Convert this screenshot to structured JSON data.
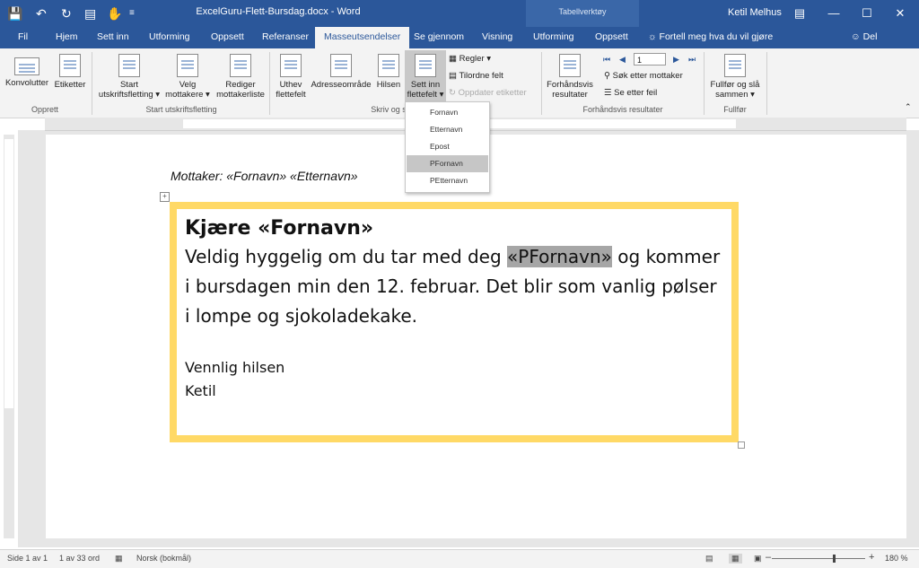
{
  "titlebar": {
    "doc_title": "ExcelGuru-Flett-Bursdag.docx - Word",
    "context_tab": "Tabellverktøy",
    "user": "Ketil Melhus",
    "qa_icons": [
      "save-icon",
      "undo-icon",
      "redo-icon",
      "print-preview-icon",
      "touch-mode-icon",
      "customize-icon"
    ]
  },
  "tabs": {
    "file": "Fil",
    "home": "Hjem",
    "insert": "Sett inn",
    "design": "Utforming",
    "layout": "Oppsett",
    "references": "Referanser",
    "mailings": "Masseutsendelser",
    "review": "Se gjennom",
    "view": "Visning",
    "table_design": "Utforming",
    "table_layout": "Oppsett",
    "tellme": "Fortell meg hva du vil gjøre",
    "share": "Del"
  },
  "ribbon": {
    "envelopes": "Konvolutter",
    "labels": "Etiketter",
    "group_create": "Opprett",
    "start_merge": [
      "Start",
      "utskriftsfletting"
    ],
    "select_recipients": [
      "Velg",
      "mottakere"
    ],
    "edit_recipients": [
      "Rediger",
      "mottakerliste"
    ],
    "group_start": "Start utskriftsfletting",
    "highlight": [
      "Uthev",
      "flettefelt"
    ],
    "address_block": "Adresseområde",
    "greeting": "Hilsen",
    "insert_field": [
      "Sett inn",
      "flettefelt"
    ],
    "rules": "Regler",
    "match_fields": "Tilordne felt",
    "update_labels": "Oppdater etiketter",
    "group_write": "Skriv og s",
    "preview": [
      "Forhåndsvis",
      "resultater"
    ],
    "record": "1",
    "find_recipient": "Søk etter mottaker",
    "check_errors": "Se etter feil",
    "group_preview": "Forhåndsvis resultater",
    "finish": [
      "Fullfør og slå",
      "sammen"
    ],
    "group_finish": "Fullfør"
  },
  "dropdown": {
    "items": [
      "Fornavn",
      "Etternavn",
      "Epost",
      "PFornavn",
      "PEtternavn"
    ],
    "highlighted": "PFornavn"
  },
  "document": {
    "recipient_line": "Mottaker: «Fornavn» «Etternavn»",
    "greeting": "Kjære «Fornavn»",
    "body_pre": "Veldig hyggelig om du tar med deg ",
    "body_field": "«PFornavn»",
    "body_post": " og kommer i bursdagen min den 12. februar. Det blir som vanlig pølser i lompe og sjokoladekake.",
    "closing": "Vennlig hilsen",
    "signature": "Ketil"
  },
  "statusbar": {
    "page": "Side 1 av 1",
    "words": "1 av 33 ord",
    "language": "Norsk (bokmål)",
    "zoom": "180 %"
  },
  "colors": {
    "word_blue": "#2b579a",
    "frame_yellow": "#ffd966",
    "field_highlight": "#a6a6a6"
  }
}
